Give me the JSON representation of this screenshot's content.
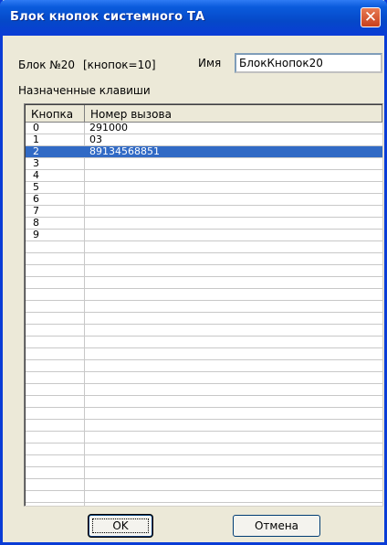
{
  "window": {
    "title": "Блок кнопок системного ТА",
    "close_icon": "close-icon"
  },
  "info": {
    "block": "Блок №20",
    "count": "[кнопок=10]",
    "name_label": "Имя",
    "name_value": "БлокКнопок20"
  },
  "section_label": "Назначенные клавиши",
  "table": {
    "columns": [
      "Кнопка",
      "Номер вызова"
    ],
    "rows": [
      {
        "key": "0",
        "number": "291000"
      },
      {
        "key": "1",
        "number": "03"
      },
      {
        "key": "2",
        "number": "89134568851",
        "selected": true
      },
      {
        "key": "3",
        "number": ""
      },
      {
        "key": "4",
        "number": ""
      },
      {
        "key": "5",
        "number": ""
      },
      {
        "key": "6",
        "number": ""
      },
      {
        "key": "7",
        "number": ""
      },
      {
        "key": "8",
        "number": ""
      },
      {
        "key": "9",
        "number": ""
      }
    ],
    "empty_rows": 23
  },
  "buttons": {
    "ok": "OK",
    "cancel": "Отмена"
  },
  "colors": {
    "title_bar": "#0a3cd6",
    "selection": "#316ac5",
    "face": "#ece9d8"
  }
}
